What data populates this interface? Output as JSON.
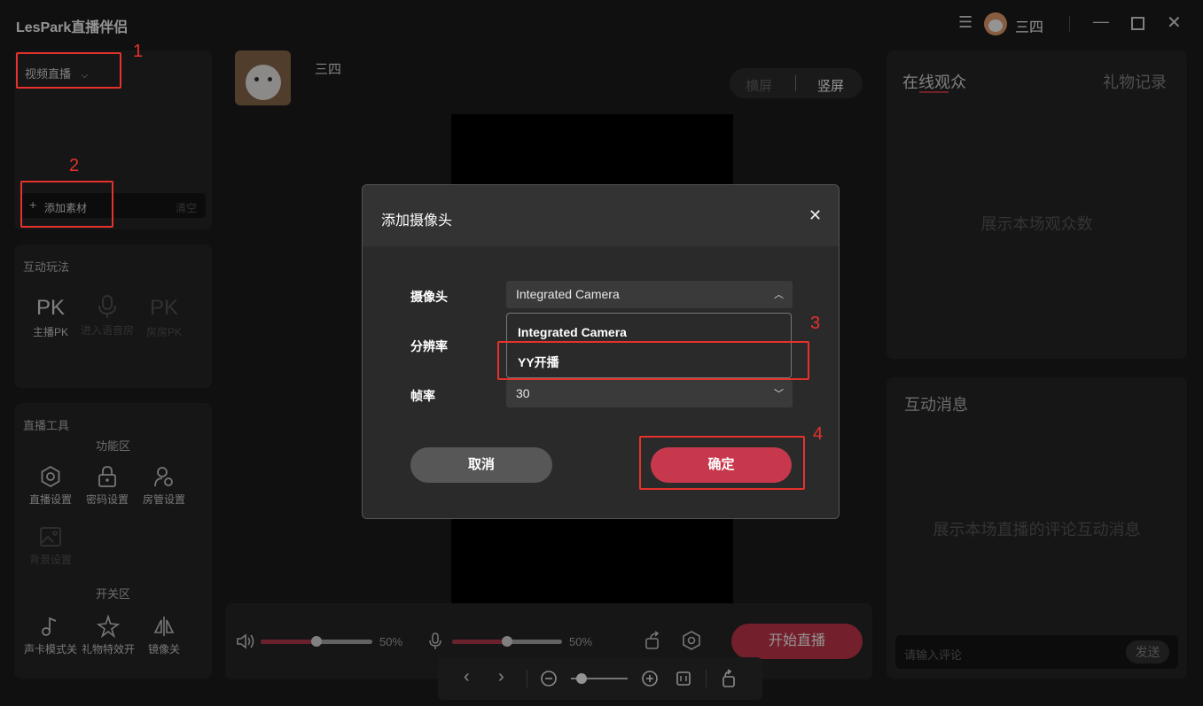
{
  "app": {
    "title": "LesPark直播伴侣",
    "user_name": "三四"
  },
  "left": {
    "mode_label": "视频直播",
    "add_material": "添加素材",
    "clear": "清空",
    "interactive_title": "互动玩法",
    "interactive_items": [
      {
        "big": "PK",
        "label": "主播PK"
      },
      {
        "big": "",
        "label": "进入语音房"
      },
      {
        "big": "PK",
        "label": "房房PK"
      }
    ],
    "tools_title": "直播工具",
    "func_area": "功能区",
    "func_items": [
      "直播设置",
      "密码设置",
      "房管设置",
      "背景设置"
    ],
    "switch_area": "开关区",
    "switch_items": [
      "声卡模式关",
      "礼物特效开",
      "镜像关"
    ]
  },
  "center": {
    "streamer_name": "三四",
    "orientation": [
      "横屏",
      "竖屏"
    ],
    "volume_pct": "50%",
    "mic_pct": "50%",
    "volume_level": 0.5,
    "mic_level": 0.5,
    "start_live": "开始直播"
  },
  "right": {
    "tab_audience": "在线观众",
    "tab_gifts": "礼物记录",
    "audience_placeholder": "展示本场观众数",
    "messages_title": "互动消息",
    "messages_placeholder": "展示本场直播的评论互动消息",
    "comment_placeholder": "请输入评论",
    "send": "发送"
  },
  "dialog": {
    "title": "添加摄像头",
    "camera_label": "摄像头",
    "camera_value": "Integrated Camera",
    "resolution_label": "分辨率",
    "framerate_label": "帧率",
    "framerate_value": "30",
    "options": [
      "Integrated Camera",
      "YY开播"
    ],
    "cancel": "取消",
    "confirm": "确定"
  },
  "annotations": [
    "1",
    "2",
    "3",
    "4"
  ],
  "colors": {
    "accent": "#c8384c",
    "annotation": "#e5322d",
    "bg": "#1c1c1c",
    "panel": "#262626"
  }
}
